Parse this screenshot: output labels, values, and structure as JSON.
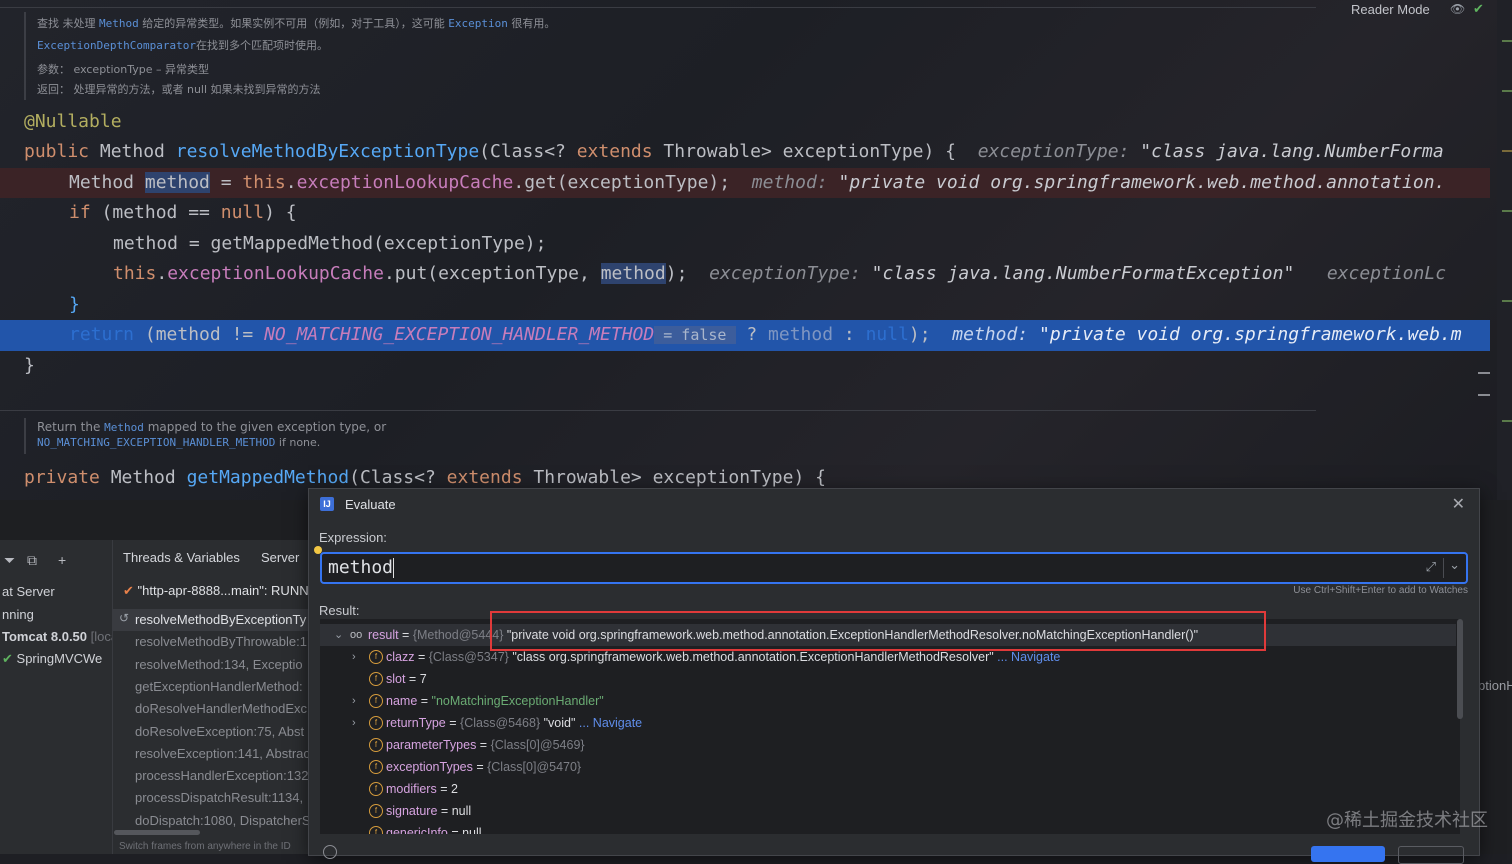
{
  "editor": {
    "reader_mode": "Reader Mode",
    "doc1": {
      "p1": "查找 未处理 ",
      "c1": "Method",
      "p2": " 给定的异常类型。如果实例不可用（例如，对于工具），这可能 ",
      "c2": "Exception",
      "p3": " 很有用。",
      "l2_code": "ExceptionDepthComparator",
      "l2_text": "在找到多个匹配项时使用。",
      "l3": "参数：  exceptionType – 异常类型",
      "l4": "返回：  处理异常的方法，或者 null 如果未找到异常的方法"
    },
    "code": {
      "ann": "@Nullable",
      "l2_kw": "public",
      "l2_type": " Method ",
      "l2_fn": "resolveMethodByExceptionType",
      "l2_p1": "(Class<? ",
      "l2_kw2": "extends",
      "l2_p2": " Throwable> exceptionType) {",
      "l2_hint": "exceptionType:",
      "l2_hintv": "\"class java.lang.NumberForma",
      "l3_p1": "Method ",
      "l3_sel": "method",
      "l3_p2": " = ",
      "l3_kw": "this",
      "l3_dot": ".",
      "l3_fld": "exceptionLookupCache",
      "l3_p3": ".get(exceptionType);",
      "l3_hint": "method:",
      "l3_hintv": "\"private void org.springframework.web.method.annotation.",
      "l4_kw": "if",
      "l4_p1": " (method == ",
      "l4_kw2": "null",
      "l4_p2": ") {",
      "l5": "method = getMappedMethod(exceptionType);",
      "l6_kw": "this",
      "l6_dot": ".",
      "l6_fld": "exceptionLookupCache",
      "l6_p1": ".put(exceptionType, ",
      "l6_sel": "method",
      "l6_p2": ");",
      "l6_hint": "exceptionType:",
      "l6_hintv": "\"class java.lang.NumberFormatException\"",
      "l6_hint2": "exceptionLc",
      "l7": "}",
      "l8_kw": "return",
      "l8_p1": " (method != ",
      "l8_cst": "NO_MATCHING_EXCEPTION_HANDLER_METHOD",
      "l8_inline": " = false ",
      "l8_p2": " ? ",
      "l8_m": "method",
      "l8_p3": " : ",
      "l8_kw2": "null",
      "l8_p4": ");",
      "l8_hint": "method:",
      "l8_hintv": "\"private void org.springframework.web.m",
      "l9": "}"
    },
    "doc2": {
      "p1": "Return the ",
      "c1": "Method",
      "p2": " mapped to the given exception type, or",
      "c2": "NO_MATCHING_EXCEPTION_HANDLER_METHOD",
      "p3": " if none."
    },
    "code2": {
      "kw": "private",
      "type": " Method ",
      "fn": "getMappedMethod",
      "p1": "(Class<? ",
      "kw2": "extends",
      "p2": " Throwable> exceptionType) {"
    }
  },
  "debugger": {
    "tabs": [
      "Threads & Variables",
      "Server"
    ],
    "left_items": [
      "at Server",
      "nning",
      "Tomcat 8.0.50",
      "SpringMVCWe"
    ],
    "left_tomcat_suffix": "[loca",
    "thread": "\"http-apr-8888...main\": RUNN",
    "frames": [
      "resolveMethodByExceptionTy",
      "resolveMethodByThrowable:1",
      "resolveMethod:134, Exceptio",
      "getExceptionHandlerMethod:",
      "doResolveHandlerMethodExc",
      "doResolveException:75, Abst",
      "resolveException:141, Abstrac",
      "processHandlerException:132",
      "processDispatchResult:1134,",
      "doDispatch:1080, DispatcherS"
    ],
    "footer_hint": "Switch frames from anywhere in the ID",
    "partial_right": "ptionH"
  },
  "evaluate": {
    "title": "Evaluate",
    "expression_label": "Expression:",
    "expression_value": "method",
    "watch_hint": "Use Ctrl+Shift+Enter to add to Watches",
    "result_label": "Result:",
    "rows": [
      {
        "name": "result",
        "eq": " = ",
        "ref": "{Method@5444}",
        "val": "\"private void org.springframework.web.method.annotation.ExceptionHandlerMethodResolver.noMatchingExceptionHandler()\"",
        "nav": ""
      },
      {
        "name": "clazz",
        "eq": " = ",
        "ref": "{Class@5347}",
        "val": "\"class org.springframework.web.method.annotation.ExceptionHandlerMethodResolver\"",
        "nav": "... Navigate"
      },
      {
        "name": "slot",
        "eq": " = ",
        "ref": "",
        "val": "7",
        "nav": ""
      },
      {
        "name": "name",
        "eq": " = ",
        "ref": "",
        "val": "\"noMatchingExceptionHandler\"",
        "nav": ""
      },
      {
        "name": "returnType",
        "eq": " = ",
        "ref": "{Class@5468}",
        "val": "\"void\"",
        "nav": "... Navigate"
      },
      {
        "name": "parameterTypes",
        "eq": " = ",
        "ref": "{Class[0]@5469}",
        "val": "",
        "nav": ""
      },
      {
        "name": "exceptionTypes",
        "eq": " = ",
        "ref": "{Class[0]@5470}",
        "val": "",
        "nav": ""
      },
      {
        "name": "modifiers",
        "eq": " = ",
        "ref": "",
        "val": "2",
        "nav": ""
      },
      {
        "name": "signature",
        "eq": " = ",
        "ref": "",
        "val": "null",
        "nav": ""
      },
      {
        "name": "genericInfo",
        "eq": " = ",
        "ref": "",
        "val": "null",
        "nav": ""
      }
    ]
  },
  "watermark": "@稀土掘金技术社区",
  "colors": {
    "accent": "#3574f0",
    "exec_line": "#2255aa",
    "highlight_box": "#e03a3a"
  }
}
